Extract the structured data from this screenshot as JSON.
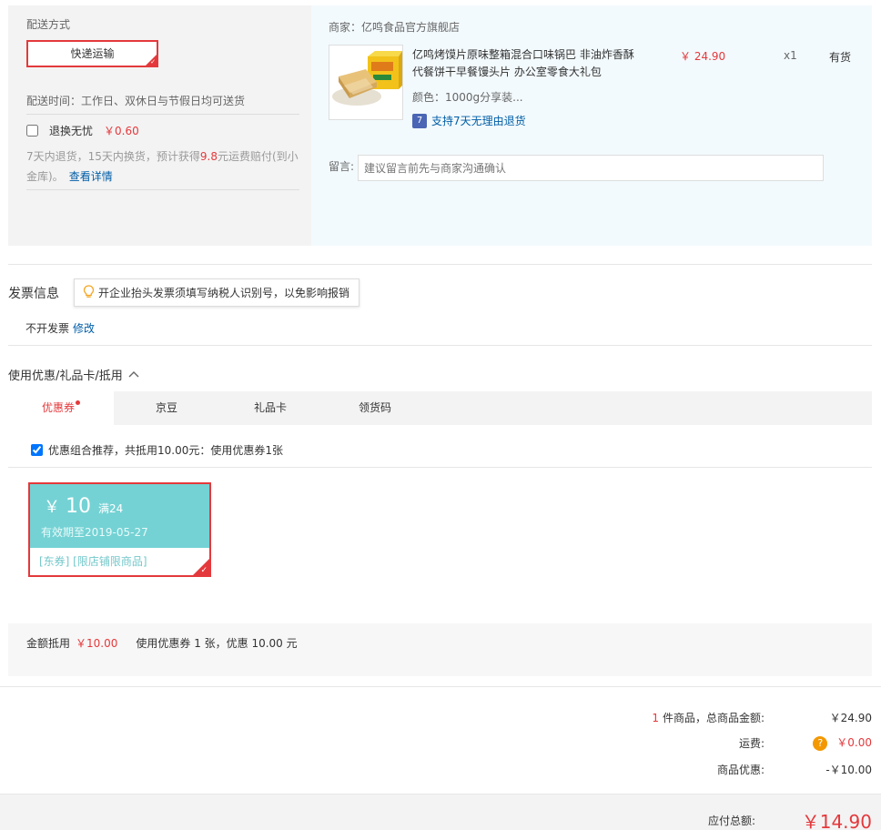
{
  "shipping": {
    "title": "配送方式",
    "method": "快递运输",
    "time": "配送时间：工作日、双休日与节假日均可送货",
    "tuihuan_label": "退换无忧",
    "tuihuan_price": "￥0.60",
    "tuihuan_desc_pre": "7天内退货，15天内换货，预计获得",
    "tuihuan_highlight": "9.8",
    "tuihuan_desc_post": "元运费赔付(到小金库)。",
    "detail_link": "查看详情"
  },
  "shop": {
    "name": "商家：亿鸣食品官方旗舰店",
    "product_title": "亿鸣烤馍片原味整箱混合口味锅巴 非油炸香酥代餐饼干早餐馒头片 办公室零食大礼包",
    "price": "￥ 24.90",
    "qty": "x1",
    "stock": "有货",
    "color": "颜色：1000g分享装...",
    "return_badge": "7",
    "return_text": "支持7天无理由退货",
    "note_label": "留言:",
    "note_placeholder": "建议留言前先与商家沟通确认"
  },
  "invoice": {
    "title": "发票信息",
    "tip": "开企业抬头发票须填写纳税人识别号，以免影响报销",
    "status": "不开发票",
    "edit": "修改"
  },
  "coupon": {
    "title": "使用优惠/礼品卡/抵用",
    "tabs": [
      "优惠券",
      "京豆",
      "礼品卡",
      "领货码"
    ],
    "recommend": "优惠组合推荐，共抵用10.00元：使用优惠券1张",
    "card": {
      "yen": "￥",
      "amount": "10",
      "condition": "满24",
      "valid": "有效期至2019-05-27",
      "scope": "[东券] [限店铺限商品]"
    },
    "summary_label": "金额抵用",
    "summary_value": "￥10.00",
    "summary_text": "使用优惠券 1 张，优惠 10.00 元"
  },
  "totals": {
    "count": "1",
    "goods_label": "件商品，总商品金额:",
    "goods_value": "￥24.90",
    "freight_label": "运费:",
    "freight_value": "￥0.00",
    "discount_label": "商品优惠:",
    "discount_value": "-￥10.00",
    "final_label": "应付总额:",
    "final_value": "￥14.90"
  },
  "colors": {
    "accent": "#e4393c",
    "link": "#005ea7",
    "coupon": "#74d2d4"
  }
}
